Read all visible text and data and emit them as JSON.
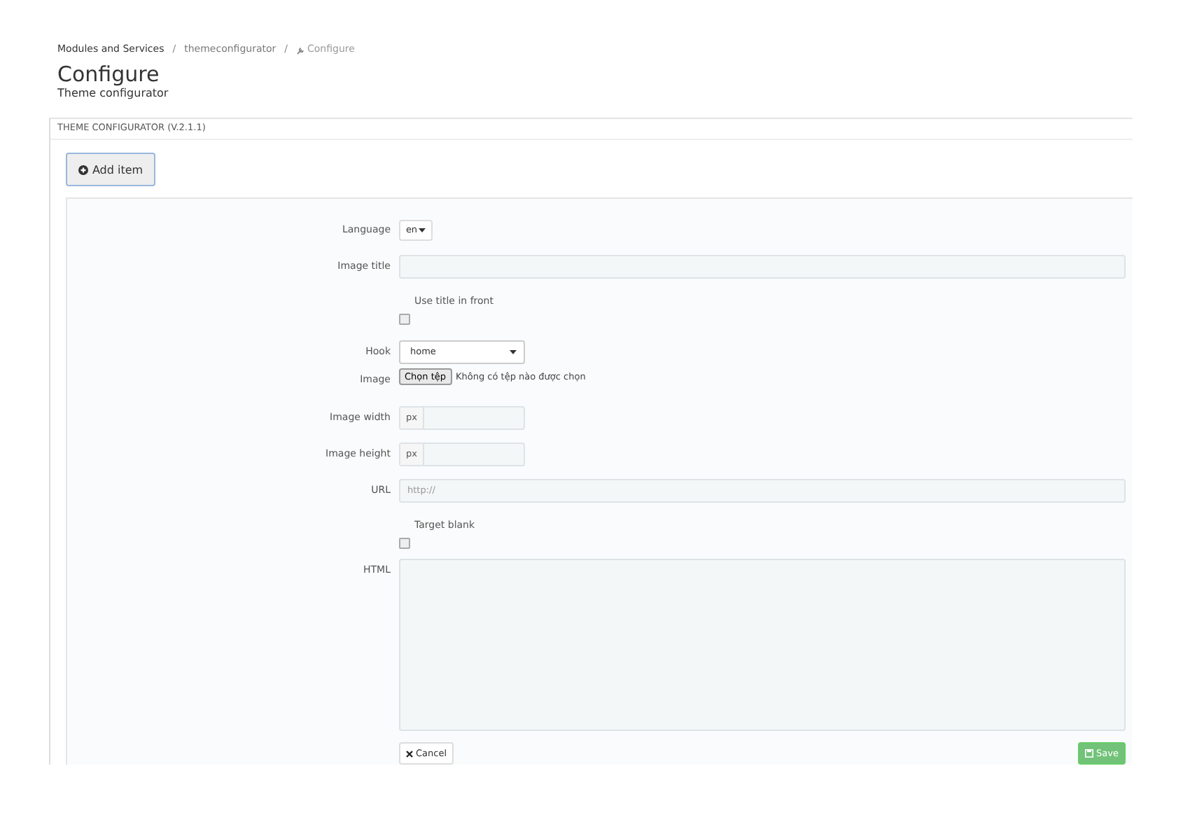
{
  "breadcrumb_separator": "/",
  "breadcrumb": [
    {
      "label": "Modules and Services",
      "current": false
    },
    {
      "label": "themeconfigurator",
      "current": false
    },
    {
      "label": "Configure",
      "current": true
    }
  ],
  "page": {
    "title": "Configure",
    "subtitle": "Theme configurator"
  },
  "panel": {
    "heading": "THEME CONFIGURATOR (V.2.1.1)",
    "add_button": "Add item"
  },
  "form": {
    "fields": [
      {
        "kind": "select-small",
        "label": "Language",
        "value": "en"
      },
      {
        "kind": "text",
        "label": "Image title"
      },
      {
        "kind": "checkbox",
        "label": "Use title in front",
        "checked": false
      },
      {
        "kind": "select",
        "label": "Hook",
        "value": "home"
      },
      {
        "kind": "file",
        "label": "Image",
        "button": "Chọn tệp",
        "status": "Không có tệp nào được chọn"
      },
      {
        "kind": "px",
        "label": "Image width",
        "addon": "px"
      },
      {
        "kind": "px",
        "label": "Image height",
        "addon": "px"
      },
      {
        "kind": "text",
        "label": "URL",
        "placeholder": "http://"
      },
      {
        "kind": "checkbox",
        "label": "Target blank",
        "checked": false
      },
      {
        "kind": "textarea",
        "label": "HTML"
      }
    ],
    "cancel": "Cancel",
    "save": "Save"
  }
}
